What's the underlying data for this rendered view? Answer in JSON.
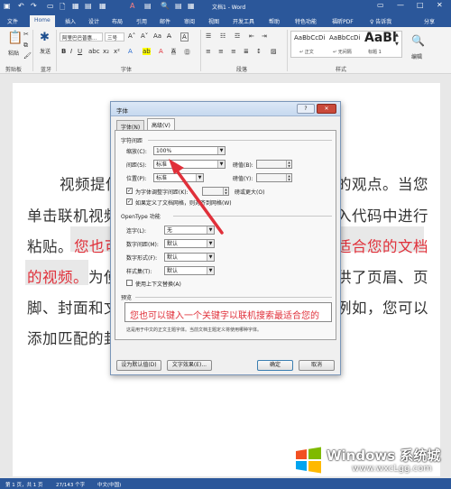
{
  "titlebar": {
    "title": "文档1 - Word",
    "qat": [
      "▣",
      "↶",
      "↷",
      "▭",
      "🗋",
      "▦",
      "▤",
      "▦",
      "A",
      "▤",
      "🔍",
      "▤",
      "▦"
    ],
    "window_controls": [
      "▭",
      "—",
      "□",
      "✕"
    ]
  },
  "tabs": [
    "文件",
    "Home",
    "插入",
    "设计",
    "布局",
    "引用",
    "邮件",
    "审阅",
    "视图",
    "开发工具",
    "帮助",
    "特色功能",
    "福昕PDF",
    "♀ 告诉我",
    "分享"
  ],
  "ribbon": {
    "groups": [
      "剪贴板",
      "蓝牙",
      "字体",
      "段落",
      "样式"
    ],
    "paste_label": "粘贴",
    "bluetooth_label": "发送",
    "font_name": "阿里巴巴普惠...",
    "font_size": "三号",
    "styles": [
      {
        "sample": "AaBbCcDi",
        "name": "↵ 正文"
      },
      {
        "sample": "AaBbCcDi",
        "name": "↵ 无间隔"
      },
      {
        "sample": "AaBl",
        "name": "标题 1"
      }
    ],
    "edit_label": "编辑"
  },
  "document": {
    "line1_left": "视频提供",
    "line1_right": "的观点。当您",
    "line2_left": "单击联机视频",
    "line2_right": "入代码中进行",
    "line3_left": "粘贴。",
    "line3_red_left": "您也可",
    "line3_red_right": "适合您的文档",
    "line4_red": "的视频。",
    "line4_left": "为使",
    "line4_right": "供了页眉、页",
    "line5_left": "脚、封面和文",
    "line5_right": "例如，您可以",
    "line6_left": "添加匹配的封"
  },
  "dialog": {
    "title": "字体",
    "help_btn": "?",
    "close_btn": "✕",
    "tabs": [
      "字体(N)",
      "高级(V)"
    ],
    "char_spacing_section": "字符间距",
    "scale_label": "缩放(C):",
    "scale_value": "100%",
    "spacing_label": "间距(S):",
    "spacing_value": "标准",
    "spacing_by_label": "磅值(B):",
    "position_label": "位置(P):",
    "position_value": "标准",
    "position_by_label": "磅值(Y):",
    "kerning_label": "为字体调整字间距(K):",
    "kerning_suffix": "磅或更大(O)",
    "grid_label": "如果定义了文档网格，则对齐到网格(W)",
    "opentype_section": "OpenType 功能",
    "ligatures_label": "连字(L):",
    "ligatures_value": "无",
    "num_spacing_label": "数字间距(M):",
    "num_spacing_value": "默认",
    "num_forms_label": "数字形式(F):",
    "num_forms_value": "默认",
    "stylistic_label": "样式集(T):",
    "stylistic_value": "默认",
    "contextual_label": "使用上下文替换(A)",
    "preview_section": "预览",
    "preview_text": "您也可以键入一个关键字以联机搜索最适合您的",
    "preview_note": "这是用于中文的正文主题字体。当前文档主题定义将使用哪种字体。",
    "default_btn": "设为默认值(D)",
    "effects_btn": "文字效果(E)...",
    "ok_btn": "确定",
    "cancel_btn": "取消"
  },
  "statusbar": {
    "page": "第 1 页，共 1 页",
    "words": "27/143 个字",
    "lang": "中文(中国)"
  },
  "watermark": {
    "title": "Windows 系统城",
    "url": "www.wxcLgg.com"
  },
  "colors": {
    "accent": "#2b579a",
    "red_text": "#e0303a",
    "arrow": "#e0303a"
  }
}
